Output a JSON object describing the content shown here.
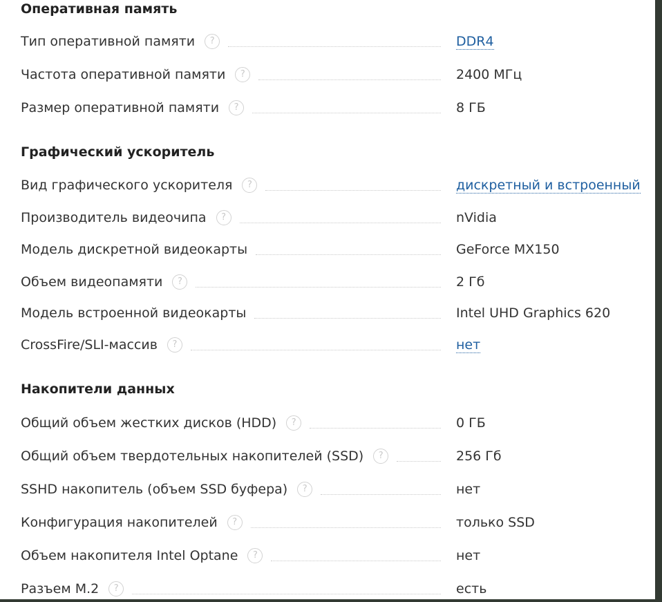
{
  "sections": [
    {
      "title": "Оперативная память",
      "rows": [
        {
          "name": "Тип оперативной памяти",
          "value": "DDR4",
          "help": true,
          "link": true
        },
        {
          "name": "Частота оперативной памяти",
          "value": "2400 МГц",
          "help": true,
          "link": false
        },
        {
          "name": "Размер оперативной памяти",
          "value": "8 ГБ",
          "help": true,
          "link": false
        }
      ]
    },
    {
      "title": "Графический ускоритель",
      "rows": [
        {
          "name": "Вид графического ускорителя",
          "value": "дискретный и встроенный",
          "help": true,
          "link": true
        },
        {
          "name": "Производитель видеочипа",
          "value": "nVidia",
          "help": true,
          "link": false
        },
        {
          "name": "Модель дискретной видеокарты",
          "value": "GeForce MX150",
          "help": false,
          "link": false
        },
        {
          "name": "Объем видеопамяти",
          "value": "2 Гб",
          "help": true,
          "link": false
        },
        {
          "name": "Модель встроенной видеокарты",
          "value": "Intel UHD Graphics 620",
          "help": false,
          "link": false
        },
        {
          "name": "CrossFire/SLI-массив",
          "value": "нет",
          "help": true,
          "link": true
        }
      ]
    },
    {
      "title": "Накопители данных",
      "rows": [
        {
          "name": "Общий объем жестких дисков (HDD)",
          "value": "0 ГБ",
          "help": true,
          "link": false
        },
        {
          "name": "Общий объем твердотельных накопителей (SSD)",
          "value": "256 Гб",
          "help": true,
          "link": false
        },
        {
          "name": "SSHD накопитель (объем SSD буфера)",
          "value": "нет",
          "help": true,
          "link": false
        },
        {
          "name": "Конфигурация накопителей",
          "value": "только SSD",
          "help": true,
          "link": false
        },
        {
          "name": "Объем накопителя Intel Optane",
          "value": "нет",
          "help": true,
          "link": false
        },
        {
          "name": "Разъем M.2",
          "value": "есть",
          "help": true,
          "link": false
        }
      ]
    }
  ],
  "help_icon_glyph": "?",
  "colors": {
    "link": "#1f5fa0",
    "text": "#333333",
    "help_icon": "#c8c8c8"
  }
}
